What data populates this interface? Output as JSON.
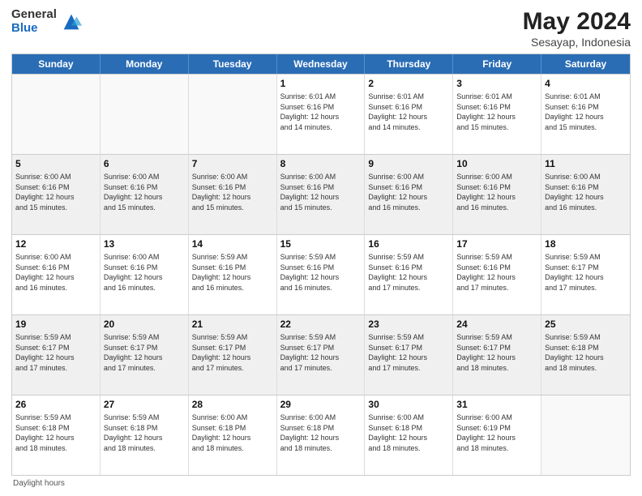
{
  "logo": {
    "general": "General",
    "blue": "Blue"
  },
  "header": {
    "title": "May 2024",
    "subtitle": "Sesayap, Indonesia"
  },
  "weekdays": [
    "Sunday",
    "Monday",
    "Tuesday",
    "Wednesday",
    "Thursday",
    "Friday",
    "Saturday"
  ],
  "weeks": [
    [
      {
        "day": "",
        "info": ""
      },
      {
        "day": "",
        "info": ""
      },
      {
        "day": "",
        "info": ""
      },
      {
        "day": "1",
        "info": "Sunrise: 6:01 AM\nSunset: 6:16 PM\nDaylight: 12 hours\nand 14 minutes."
      },
      {
        "day": "2",
        "info": "Sunrise: 6:01 AM\nSunset: 6:16 PM\nDaylight: 12 hours\nand 14 minutes."
      },
      {
        "day": "3",
        "info": "Sunrise: 6:01 AM\nSunset: 6:16 PM\nDaylight: 12 hours\nand 15 minutes."
      },
      {
        "day": "4",
        "info": "Sunrise: 6:01 AM\nSunset: 6:16 PM\nDaylight: 12 hours\nand 15 minutes."
      }
    ],
    [
      {
        "day": "5",
        "info": "Sunrise: 6:00 AM\nSunset: 6:16 PM\nDaylight: 12 hours\nand 15 minutes."
      },
      {
        "day": "6",
        "info": "Sunrise: 6:00 AM\nSunset: 6:16 PM\nDaylight: 12 hours\nand 15 minutes."
      },
      {
        "day": "7",
        "info": "Sunrise: 6:00 AM\nSunset: 6:16 PM\nDaylight: 12 hours\nand 15 minutes."
      },
      {
        "day": "8",
        "info": "Sunrise: 6:00 AM\nSunset: 6:16 PM\nDaylight: 12 hours\nand 15 minutes."
      },
      {
        "day": "9",
        "info": "Sunrise: 6:00 AM\nSunset: 6:16 PM\nDaylight: 12 hours\nand 16 minutes."
      },
      {
        "day": "10",
        "info": "Sunrise: 6:00 AM\nSunset: 6:16 PM\nDaylight: 12 hours\nand 16 minutes."
      },
      {
        "day": "11",
        "info": "Sunrise: 6:00 AM\nSunset: 6:16 PM\nDaylight: 12 hours\nand 16 minutes."
      }
    ],
    [
      {
        "day": "12",
        "info": "Sunrise: 6:00 AM\nSunset: 6:16 PM\nDaylight: 12 hours\nand 16 minutes."
      },
      {
        "day": "13",
        "info": "Sunrise: 6:00 AM\nSunset: 6:16 PM\nDaylight: 12 hours\nand 16 minutes."
      },
      {
        "day": "14",
        "info": "Sunrise: 5:59 AM\nSunset: 6:16 PM\nDaylight: 12 hours\nand 16 minutes."
      },
      {
        "day": "15",
        "info": "Sunrise: 5:59 AM\nSunset: 6:16 PM\nDaylight: 12 hours\nand 16 minutes."
      },
      {
        "day": "16",
        "info": "Sunrise: 5:59 AM\nSunset: 6:16 PM\nDaylight: 12 hours\nand 17 minutes."
      },
      {
        "day": "17",
        "info": "Sunrise: 5:59 AM\nSunset: 6:16 PM\nDaylight: 12 hours\nand 17 minutes."
      },
      {
        "day": "18",
        "info": "Sunrise: 5:59 AM\nSunset: 6:17 PM\nDaylight: 12 hours\nand 17 minutes."
      }
    ],
    [
      {
        "day": "19",
        "info": "Sunrise: 5:59 AM\nSunset: 6:17 PM\nDaylight: 12 hours\nand 17 minutes."
      },
      {
        "day": "20",
        "info": "Sunrise: 5:59 AM\nSunset: 6:17 PM\nDaylight: 12 hours\nand 17 minutes."
      },
      {
        "day": "21",
        "info": "Sunrise: 5:59 AM\nSunset: 6:17 PM\nDaylight: 12 hours\nand 17 minutes."
      },
      {
        "day": "22",
        "info": "Sunrise: 5:59 AM\nSunset: 6:17 PM\nDaylight: 12 hours\nand 17 minutes."
      },
      {
        "day": "23",
        "info": "Sunrise: 5:59 AM\nSunset: 6:17 PM\nDaylight: 12 hours\nand 17 minutes."
      },
      {
        "day": "24",
        "info": "Sunrise: 5:59 AM\nSunset: 6:17 PM\nDaylight: 12 hours\nand 18 minutes."
      },
      {
        "day": "25",
        "info": "Sunrise: 5:59 AM\nSunset: 6:18 PM\nDaylight: 12 hours\nand 18 minutes."
      }
    ],
    [
      {
        "day": "26",
        "info": "Sunrise: 5:59 AM\nSunset: 6:18 PM\nDaylight: 12 hours\nand 18 minutes."
      },
      {
        "day": "27",
        "info": "Sunrise: 5:59 AM\nSunset: 6:18 PM\nDaylight: 12 hours\nand 18 minutes."
      },
      {
        "day": "28",
        "info": "Sunrise: 6:00 AM\nSunset: 6:18 PM\nDaylight: 12 hours\nand 18 minutes."
      },
      {
        "day": "29",
        "info": "Sunrise: 6:00 AM\nSunset: 6:18 PM\nDaylight: 12 hours\nand 18 minutes."
      },
      {
        "day": "30",
        "info": "Sunrise: 6:00 AM\nSunset: 6:18 PM\nDaylight: 12 hours\nand 18 minutes."
      },
      {
        "day": "31",
        "info": "Sunrise: 6:00 AM\nSunset: 6:19 PM\nDaylight: 12 hours\nand 18 minutes."
      },
      {
        "day": "",
        "info": ""
      }
    ]
  ],
  "footer": {
    "daylight_label": "Daylight hours"
  }
}
